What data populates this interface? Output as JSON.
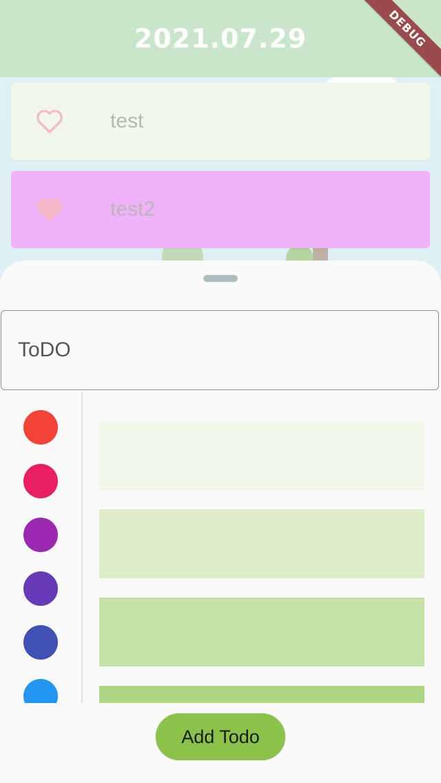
{
  "appbar": {
    "title": "2021.07.29",
    "banner": "DEBUG"
  },
  "todos": [
    {
      "label": "test",
      "favorite": false,
      "color": "#f1f8e9"
    },
    {
      "label": "test2",
      "favorite": true,
      "color": "#f0b2fa"
    }
  ],
  "sheet": {
    "input": {
      "value": "ToDO",
      "placeholder": ""
    },
    "palette": [
      {
        "name": "red",
        "color": "#f44336"
      },
      {
        "name": "pink",
        "color": "#e91e63"
      },
      {
        "name": "purple",
        "color": "#9c27b0"
      },
      {
        "name": "deep-purple",
        "color": "#673ab7"
      },
      {
        "name": "indigo",
        "color": "#3f51b5"
      },
      {
        "name": "blue",
        "color": "#2196f3"
      }
    ],
    "shades": [
      {
        "color": "#f1f8e9"
      },
      {
        "color": "#dcedc8"
      },
      {
        "color": "#c5e1a5"
      },
      {
        "color": "#aed581"
      }
    ],
    "add_label": "Add Todo"
  },
  "colors": {
    "appbar": "#c9e6ca",
    "heart": "#f6b7c7",
    "accent": "#8bc34a"
  }
}
